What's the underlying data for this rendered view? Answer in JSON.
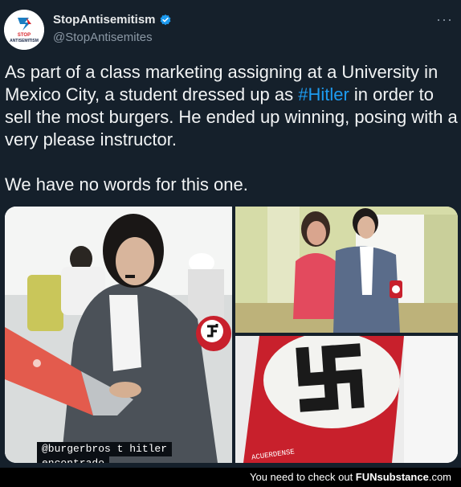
{
  "account": {
    "display_name": "StopAntisemitism",
    "handle": "@StopAntisemites",
    "avatar_text_top": "STOP",
    "avatar_text_bottom": "ANTISEMITISM",
    "more_label": "···"
  },
  "tweet": {
    "text_before_hashtag": "As part of a class marketing assigning at a University in Mexico City, a student dressed up as ",
    "hashtag": "#Hitler",
    "text_after_hashtag": " in order to sell the most burgers. He ended up winning, posing with a very please instructor.",
    "second_paragraph": "We have no words for this one."
  },
  "media": {
    "story_tag_line1": "@burgerbros t hitler",
    "story_tag_line2": "encontrado",
    "armband_text": "ACUERDENSE"
  },
  "footer": {
    "prefix": "You need to check out ",
    "brand_fun": "FUN",
    "brand_sub": "substance",
    "brand_tld": ".com"
  },
  "colors": {
    "background": "#15202b",
    "hashtag": "#1d9bf0",
    "verified": "#1d9bf0",
    "armband": "#c8202c"
  }
}
